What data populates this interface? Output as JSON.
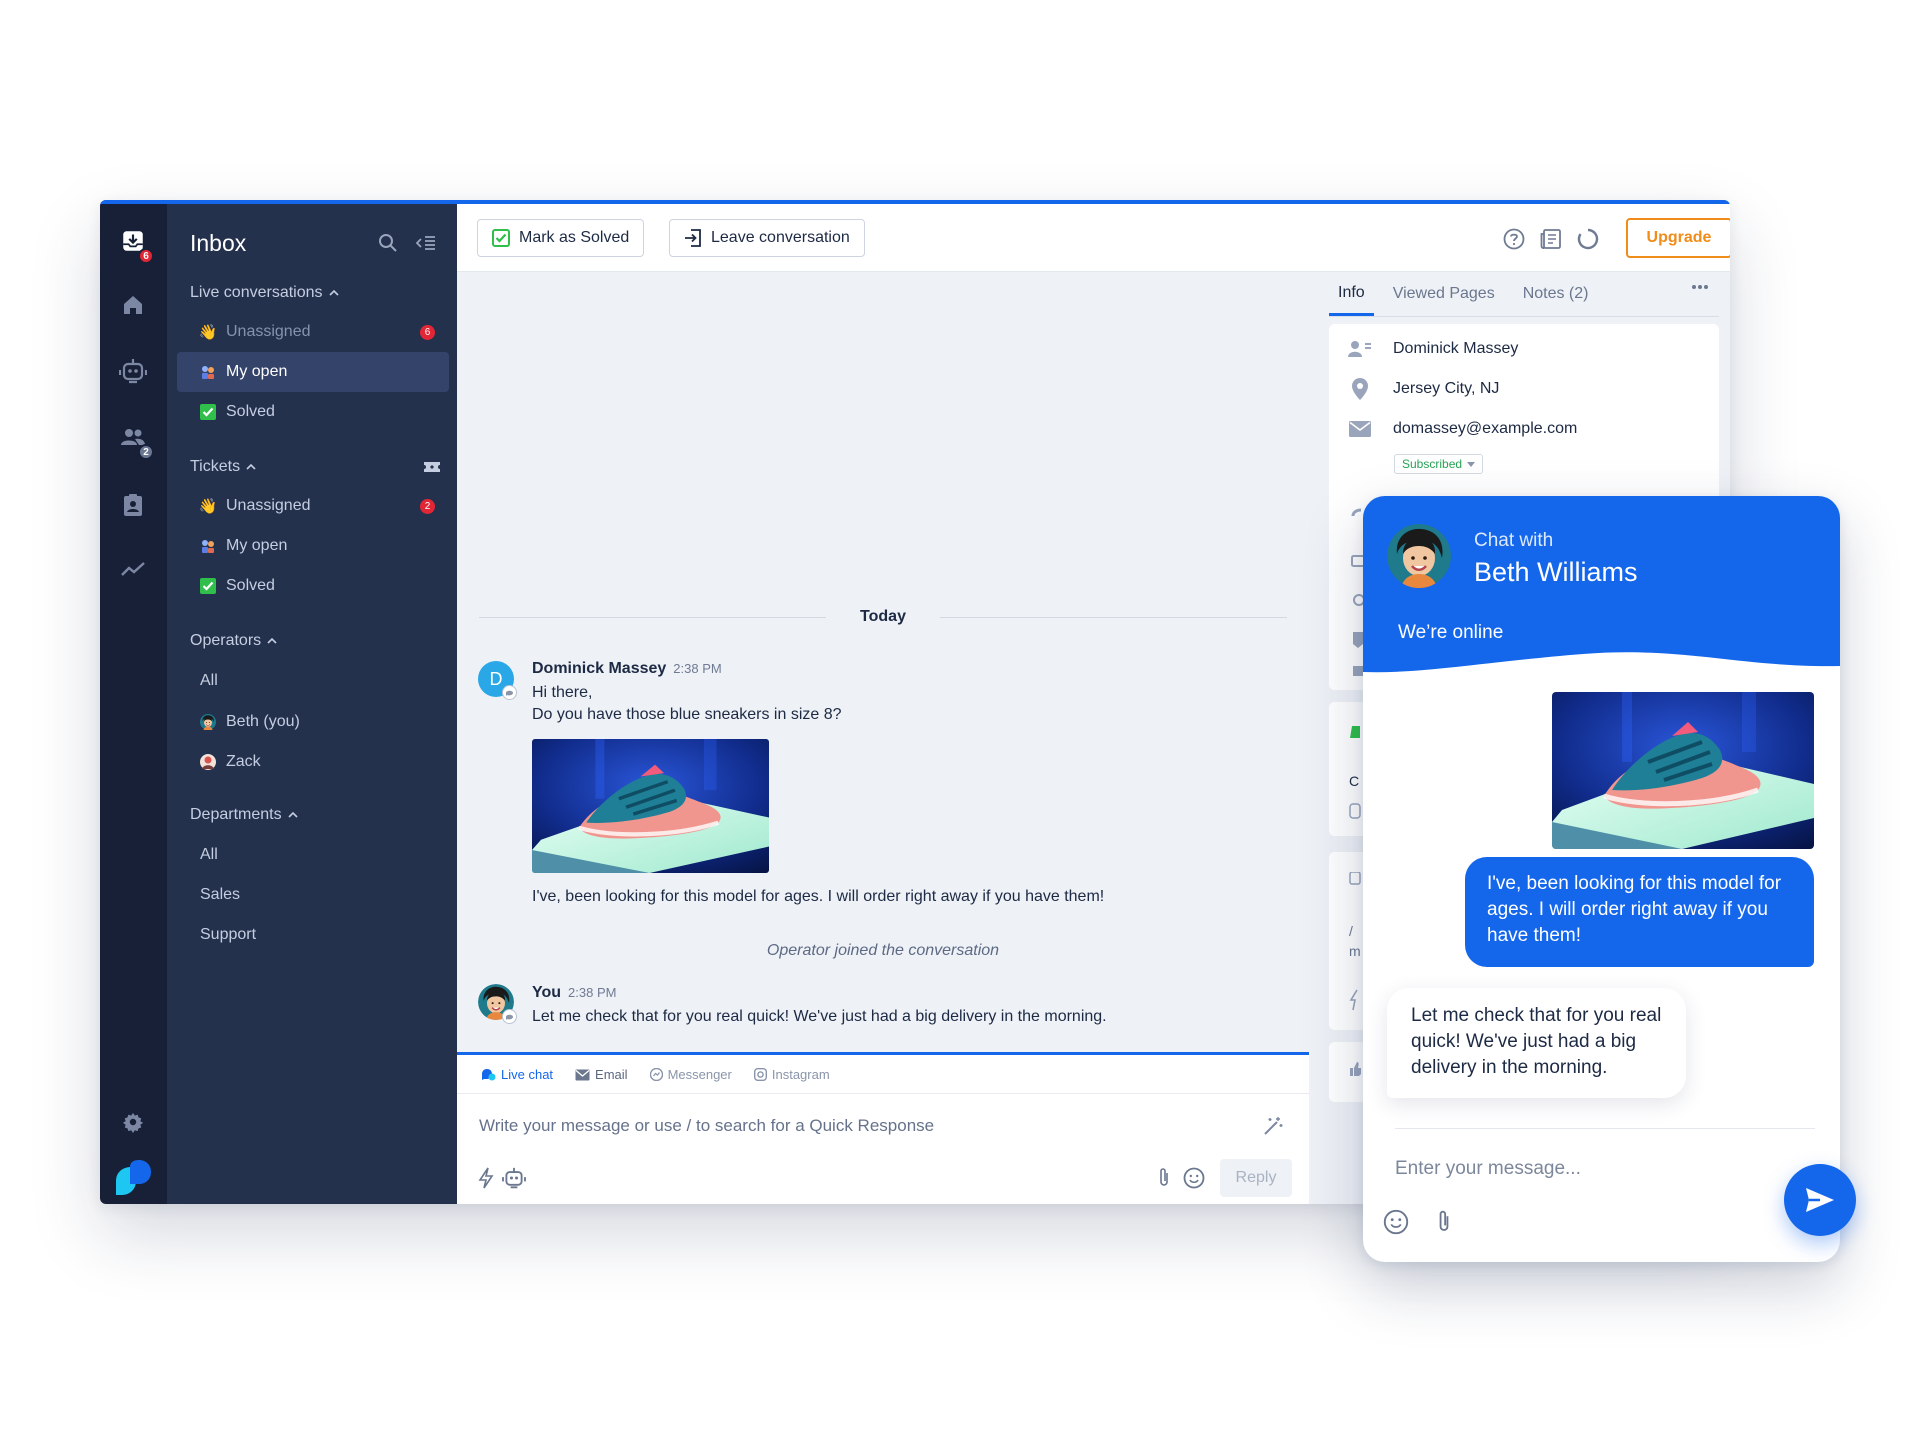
{
  "sidebar": {
    "title": "Inbox",
    "rail_badges": {
      "inbox": "6",
      "contacts": "2"
    },
    "live": {
      "label": "Live conversations",
      "items": [
        {
          "label": "Unassigned",
          "icon": "waving-hand-icon",
          "count": "6"
        },
        {
          "label": "My open",
          "icon": "people-icon",
          "count": ""
        },
        {
          "label": "Solved",
          "icon": "check-box-icon",
          "count": ""
        }
      ]
    },
    "tickets": {
      "label": "Tickets",
      "items": [
        {
          "label": "Unassigned",
          "icon": "waving-hand-icon",
          "count": "2"
        },
        {
          "label": "My open",
          "icon": "people-icon",
          "count": ""
        },
        {
          "label": "Solved",
          "icon": "check-box-icon",
          "count": ""
        }
      ]
    },
    "operators": {
      "label": "Operators",
      "items": [
        {
          "label": "All"
        },
        {
          "label": "Beth (you)"
        },
        {
          "label": "Zack"
        }
      ]
    },
    "departments": {
      "label": "Departments",
      "items": [
        {
          "label": "All"
        },
        {
          "label": "Sales"
        },
        {
          "label": "Support"
        }
      ]
    }
  },
  "toolbar": {
    "mark_solved": "Mark as Solved",
    "leave": "Leave conversation",
    "upgrade": "Upgrade"
  },
  "conversation": {
    "divider": "Today",
    "visitor": {
      "initial": "D",
      "name": "Dominick Massey",
      "time": "2:38 PM",
      "line1": "Hi there,",
      "line2": "Do you have those blue sneakers in size 8?",
      "caption": "I've, been looking for this model for ages. I will order right away if you have them!"
    },
    "system_note": "Operator joined the conversation",
    "operator": {
      "name": "You",
      "time": "2:38 PM",
      "text": "Let me check that for you real quick! We've just had a big delivery in the morning."
    }
  },
  "composer": {
    "tabs": [
      "Live chat",
      "Email",
      "Messenger",
      "Instagram"
    ],
    "placeholder": "Write your message or use / to search for a Quick Response",
    "reply": "Reply"
  },
  "info": {
    "tabs": [
      "Info",
      "Viewed Pages",
      "Notes (2)"
    ],
    "name": "Dominick Massey",
    "location": "Jersey City, NJ",
    "email": "domassey@example.com",
    "subscription": "Subscribed"
  },
  "widget": {
    "chat_with": "Chat with",
    "agent_name": "Beth Williams",
    "status": "We’re online",
    "visitor_message": "I've, been looking for this model for ages. I will order right away if you have them!",
    "agent_message": "Let me check that for you real quick! We've just had a big delivery in the morning.",
    "input_placeholder": "Enter your message..."
  },
  "colors": {
    "accent": "#1467eb",
    "rail": "#172037",
    "sidebar": "#24314d",
    "upgrade": "#f08c1a",
    "badge": "#e32636",
    "online": "#23c16b"
  }
}
